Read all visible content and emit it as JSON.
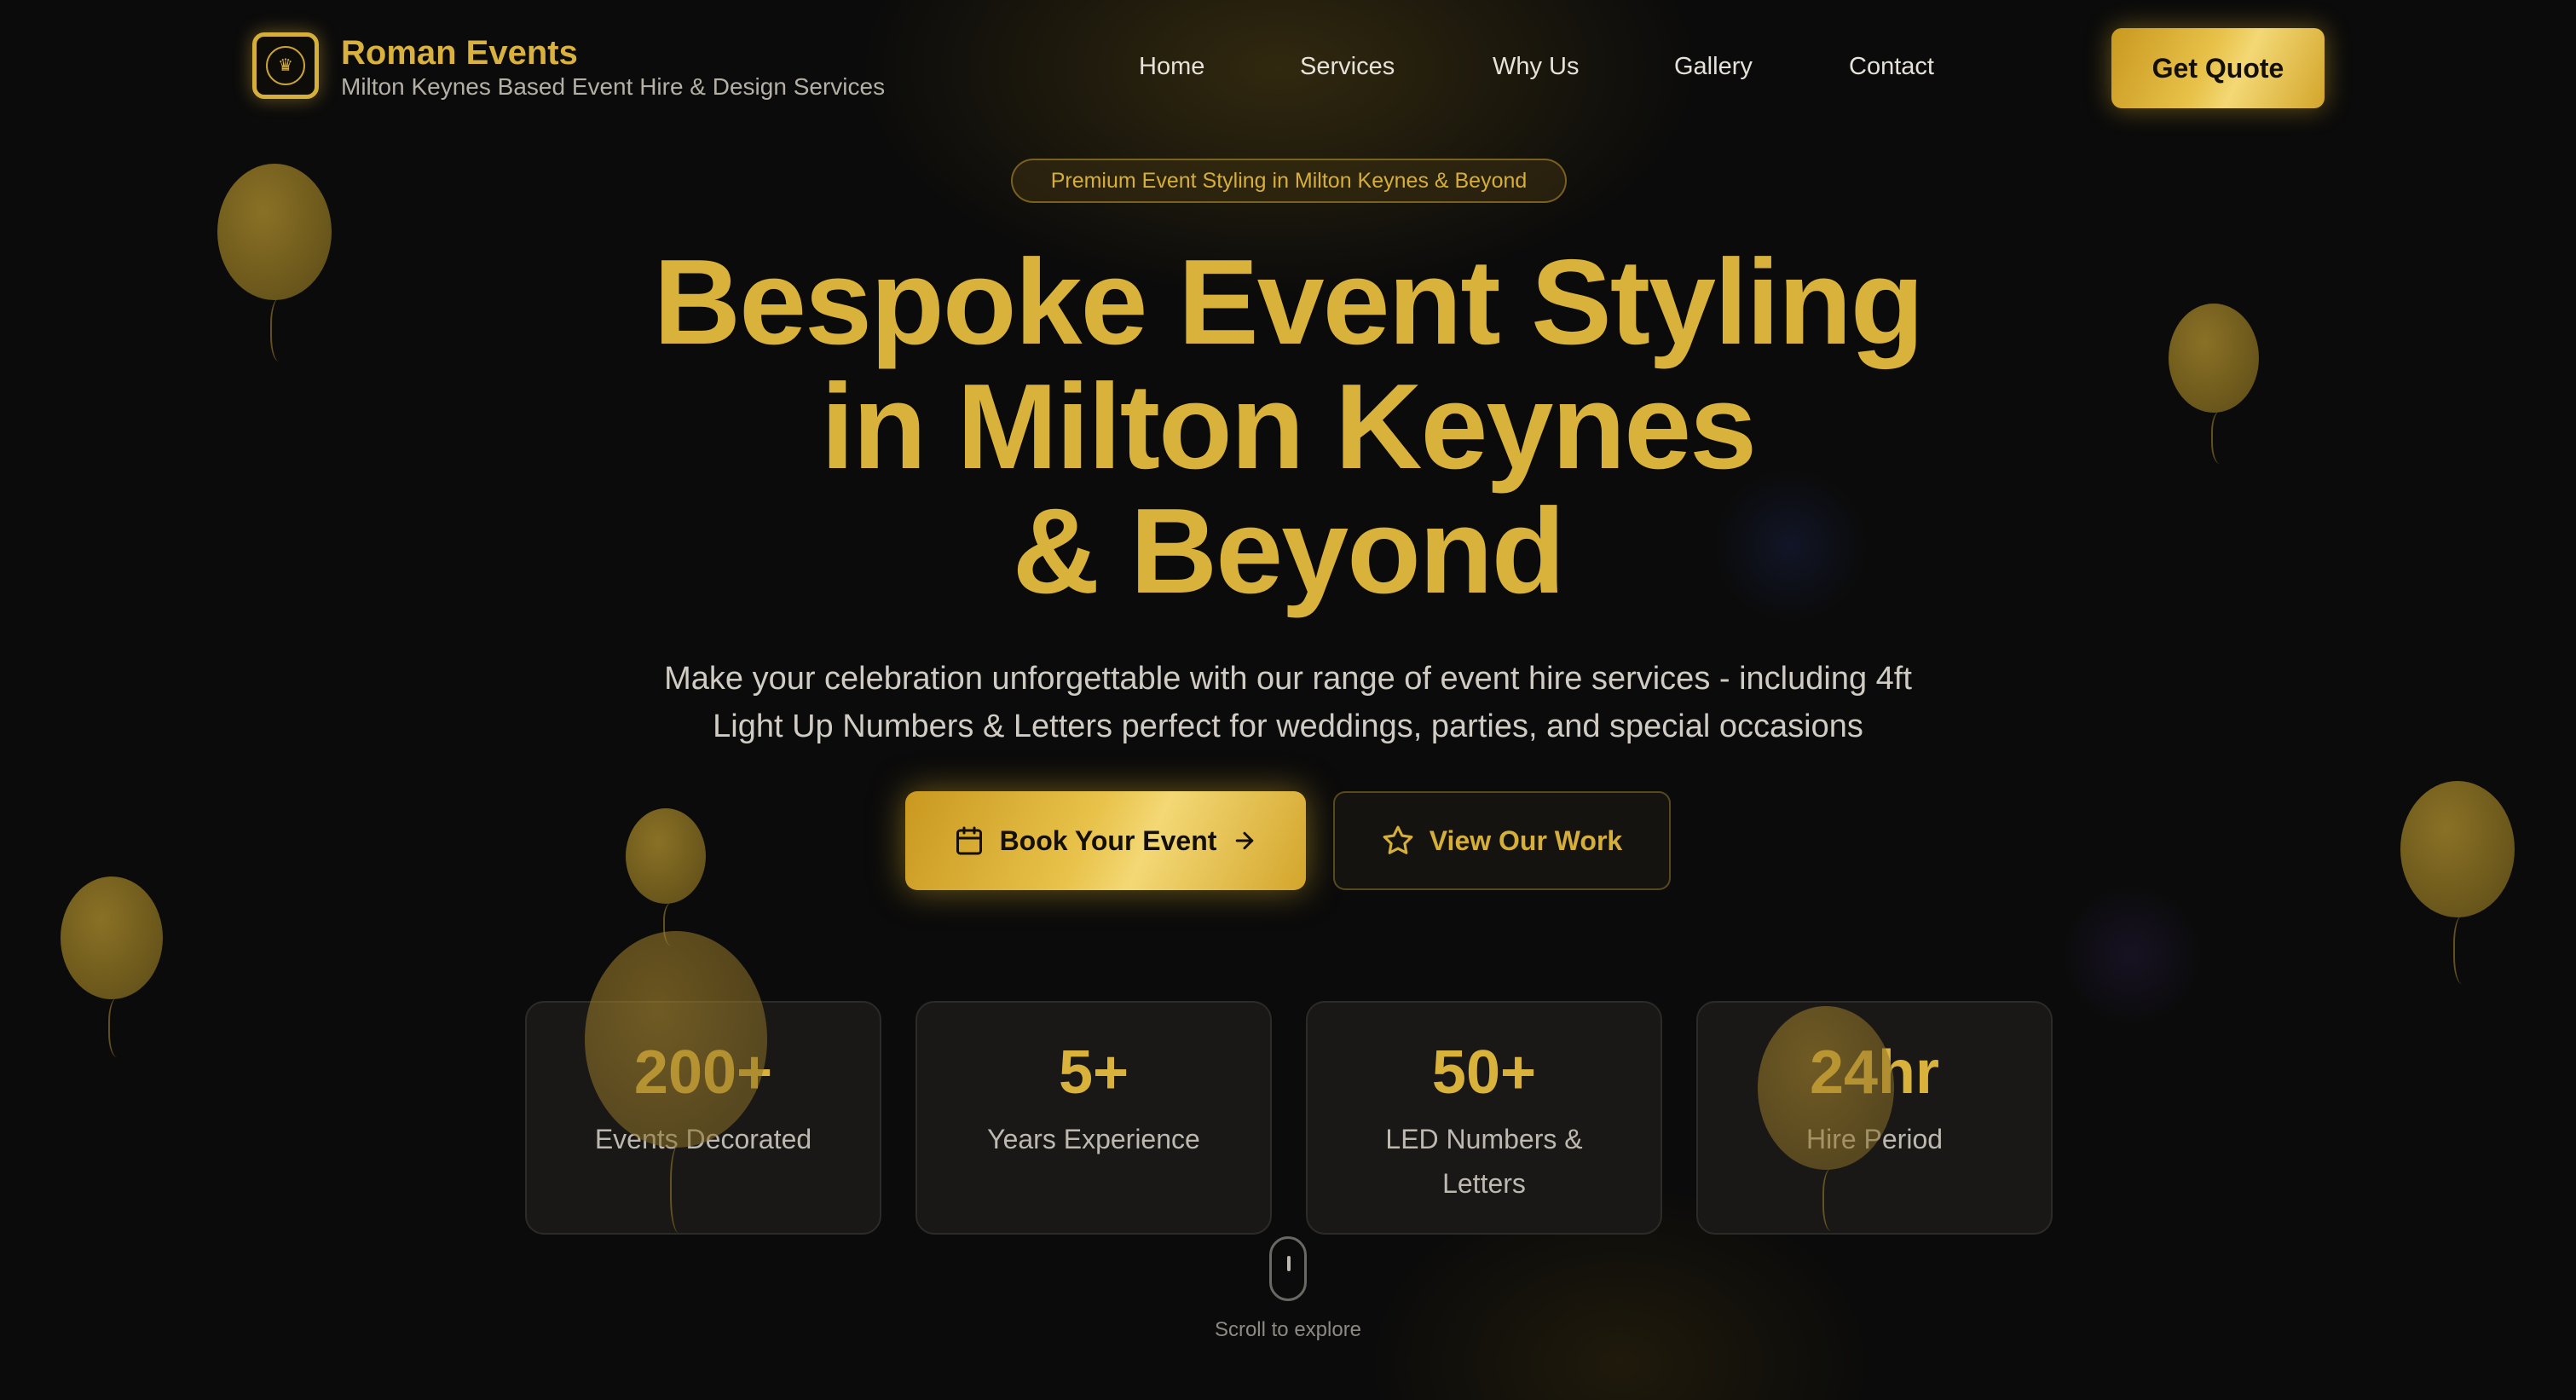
{
  "brand": {
    "name": "Roman Events",
    "tagline": "Milton Keynes Based Event Hire & Design Services",
    "logo_icon": "crest-icon"
  },
  "nav": {
    "items": [
      {
        "label": "Home"
      },
      {
        "label": "Services"
      },
      {
        "label": "Why Us"
      },
      {
        "label": "Gallery"
      },
      {
        "label": "Contact"
      }
    ],
    "cta_label": "Get Quote"
  },
  "hero": {
    "badge": "Premium Event Styling in Milton Keynes & Beyond",
    "title_lines": [
      "Bespoke Event Styling",
      "in Milton Keynes",
      "& Beyond"
    ],
    "subtitle_line1": "Make your celebration unforgettable with our range of event hire services - including 4ft",
    "subtitle_line2": "Light Up Numbers & Letters perfect for weddings, parties, and special occasions",
    "primary_button": {
      "label": "Book Your Event",
      "icon": "calendar-icon",
      "trailing_icon": "arrow-right-icon"
    },
    "secondary_button": {
      "label": "View Our Work",
      "icon": "star-icon"
    }
  },
  "stats": [
    {
      "value": "200+",
      "label": "Events Decorated"
    },
    {
      "value": "5+",
      "label": "Years Experience"
    },
    {
      "value": "50+",
      "label": "LED Numbers & Letters"
    },
    {
      "value": "24hr",
      "label": "Hire Period"
    }
  ],
  "scroll_hint": "Scroll to explore",
  "colors": {
    "background": "#0b0b0b",
    "gold": "#d9b23c",
    "gold_light": "#f3d875",
    "text_light": "#d0ccc4"
  }
}
